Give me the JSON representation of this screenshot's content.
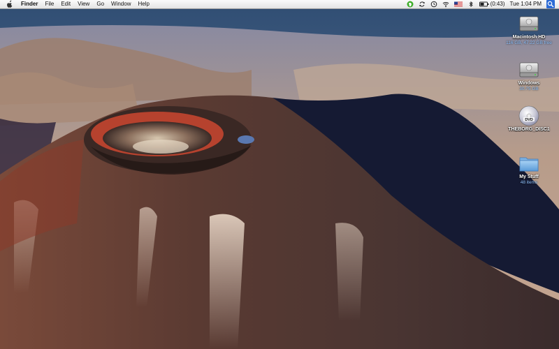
{
  "menubar": {
    "app_name": "Finder",
    "menus": [
      "File",
      "Edit",
      "View",
      "Go",
      "Window",
      "Help"
    ],
    "battery_time": "(0:43)",
    "clock": "Tue 1:04 PM",
    "status_icons": [
      "evernote-icon",
      "sync-icon",
      "time-machine-icon",
      "wifi-icon",
      "flag-icon",
      "bluetooth-icon",
      "battery-icon",
      "spotlight-icon"
    ]
  },
  "desktop": {
    "icons": [
      {
        "label": "Macintosh HD",
        "sub": "116 GB, 47.22 GB free",
        "icon": "hard-drive-icon"
      },
      {
        "label": "Windows",
        "sub": "30.75 GB",
        "icon": "hard-drive-icon"
      },
      {
        "label": "THEBORG_DISC1",
        "sub": "",
        "icon": "dvd-icon"
      },
      {
        "label": "My Stuff",
        "sub": "48 items",
        "icon": "folder-icon"
      }
    ]
  },
  "colors": {
    "sky": "#3e5f86",
    "plain": "#b69a86",
    "shadow": "#141a34",
    "volcano": "#5a3b33",
    "crater_red": "#b6422e",
    "label_blue": "#8fc3ff"
  }
}
